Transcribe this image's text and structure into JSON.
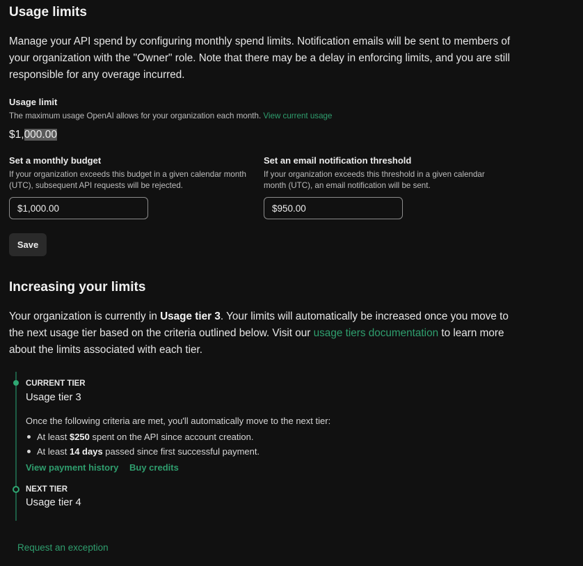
{
  "usage_limits": {
    "title": "Usage limits",
    "description": "Manage your API spend by configuring monthly spend limits. Notification emails will be sent to members of your organization with the \"Owner\" role. Note that there may be a delay in enforcing limits, and you are still responsible for any overage incurred.",
    "usage_limit": {
      "label": "Usage limit",
      "help": "The maximum usage OpenAI allows for your organization each month.",
      "help_link": "View current usage",
      "value_prefix": "$1,",
      "value_selected": "000.00"
    },
    "monthly_budget": {
      "label": "Set a monthly budget",
      "help": "If your organization exceeds this budget in a given calendar month (UTC), subsequent API requests will be rejected.",
      "value": "$1,000.00"
    },
    "email_threshold": {
      "label": "Set an email notification threshold",
      "help": "If your organization exceeds this threshold in a given calendar month (UTC), an email notification will be sent.",
      "value": "$950.00"
    },
    "save_label": "Save"
  },
  "increasing_limits": {
    "title": "Increasing your limits",
    "text_before_tier": "Your organization is currently in ",
    "current_tier_bold": "Usage tier 3",
    "text_after_tier": ". Your limits will automatically be increased once you move to the next usage tier based on the criteria outlined below. Visit our ",
    "docs_link": "usage tiers documentation",
    "text_end": " to learn more about the limits associated with each tier."
  },
  "timeline": {
    "current": {
      "caption": "CURRENT TIER",
      "name": "Usage tier 3"
    },
    "criteria_intro": "Once the following criteria are met, you'll automatically move to the next tier:",
    "criteria": [
      {
        "pre": "At least ",
        "bold": "$250",
        "post": " spent on the API since account creation."
      },
      {
        "pre": "At least ",
        "bold": "14 days",
        "post": " passed since first successful payment."
      }
    ],
    "links": {
      "payment_history": "View payment history",
      "buy_credits": "Buy credits"
    },
    "next": {
      "caption": "NEXT TIER",
      "name": "Usage tier 4"
    }
  },
  "request_exception": "Request an exception",
  "colors": {
    "background": "#111111",
    "accent_green": "#2f9e6e",
    "timeline_line": "#1d5d44"
  }
}
